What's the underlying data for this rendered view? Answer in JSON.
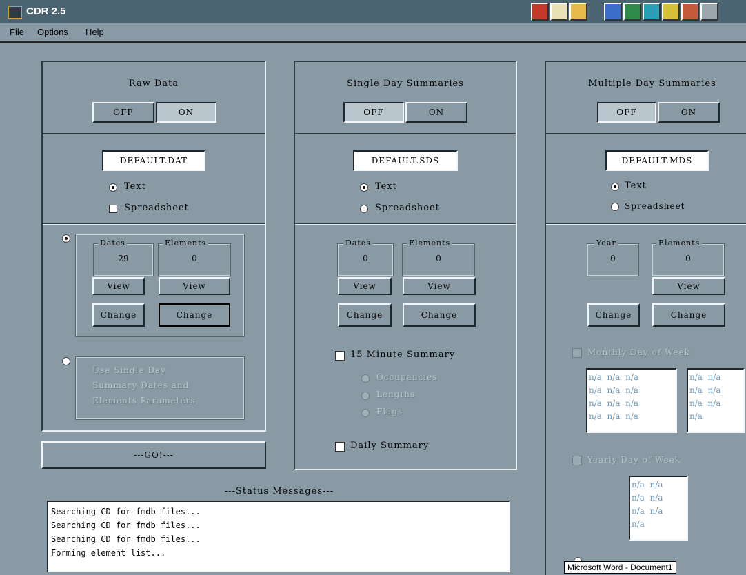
{
  "window": {
    "title": "CDR 2.5"
  },
  "toolbar_icons": [
    "pin-icon",
    "document-icon",
    "folder-icon",
    "word-icon",
    "excel-icon",
    "powerpoint-icon",
    "key-icon",
    "globe-icon",
    "settings-icon"
  ],
  "menu": [
    "File",
    "Options",
    "Help"
  ],
  "raw": {
    "title": "Raw Data",
    "off": "OFF",
    "on": "ON",
    "file": "DEFAULT.DAT",
    "text": "Text",
    "spreadsheet": "Spreadsheet",
    "dates_label": "Dates",
    "dates_value": "29",
    "elements_label": "Elements",
    "elements_value": "0",
    "view": "View",
    "change": "Change",
    "alt_text_1": "Use Single Day",
    "alt_text_2": "Summary Dates and",
    "alt_text_3": "Elements Parameters",
    "go": "---GO!---"
  },
  "single": {
    "title": "Single Day Summaries",
    "off": "OFF",
    "on": "ON",
    "file": "DEFAULT.SDS",
    "text": "Text",
    "spreadsheet": "Spreadsheet",
    "dates_label": "Dates",
    "dates_value": "0",
    "elements_label": "Elements",
    "elements_value": "0",
    "view": "View",
    "change": "Change",
    "minute_summary": "15 Minute Summary",
    "occupancies": "Occupancies",
    "lengths": "Lengths",
    "flags": "Flags",
    "daily_summary": "Daily Summary"
  },
  "multi": {
    "title": "Multiple Day Summaries",
    "off": "OFF",
    "on": "ON",
    "file": "DEFAULT.MDS",
    "text": "Text",
    "spreadsheet": "Spreadsheet",
    "year_label": "Year",
    "year_value": "0",
    "elements_label": "Elements",
    "elements_value": "0",
    "view": "View",
    "change": "Change",
    "monthly_dow": "Monthly Day of Week",
    "monthly_list_left": [
      "n/a  n/a  n/a",
      "n/a  n/a  n/a",
      "n/a  n/a  n/a",
      "n/a  n/a  n/a"
    ],
    "monthly_list_right": [
      "n/a  n/a",
      "n/a  n/a",
      "n/a  n/a",
      "n/a"
    ],
    "yearly_dow": "Yearly Day of Week",
    "yearly_list": [
      "n/a  n/a",
      "n/a  n/a",
      "n/a  n/a",
      "n/a"
    ]
  },
  "status": {
    "title": "---Status Messages---",
    "lines": [
      "Searching CD for fmdb files...",
      "Searching CD for fmdb files...",
      "Searching CD for fmdb files...",
      "Forming element list..."
    ]
  },
  "tooltip": "Microsoft Word - Document1"
}
